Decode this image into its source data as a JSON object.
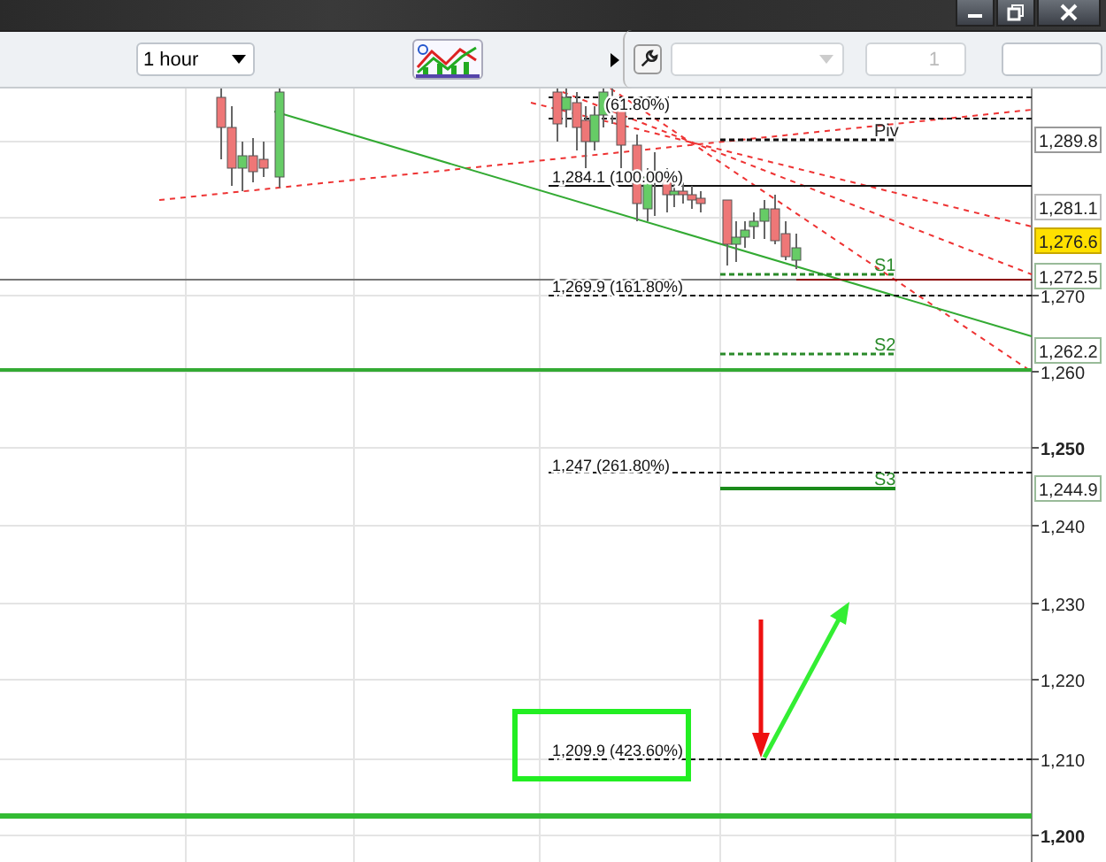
{
  "toolbar": {
    "timeframe": "1 hour",
    "quantity": {
      "value": "1",
      "disabled": true
    }
  },
  "chart": {
    "axis_labels": [
      {
        "text": "1,270",
        "major": false
      },
      {
        "text": "1,260",
        "major": false
      },
      {
        "text": "1,250",
        "major": true
      },
      {
        "text": "1,240",
        "major": false
      },
      {
        "text": "1,230",
        "major": false
      },
      {
        "text": "1,220",
        "major": false
      },
      {
        "text": "1,210",
        "major": false
      },
      {
        "text": "1,200",
        "major": true
      }
    ],
    "price_tags": [
      {
        "text": "1,289.8",
        "kind": "level"
      },
      {
        "text": "1,281.1",
        "kind": "sell"
      },
      {
        "text": "1,276.6",
        "kind": "current"
      },
      {
        "text": "1,272.5",
        "kind": "support"
      },
      {
        "text": "1,262.2",
        "kind": "support"
      },
      {
        "text": "1,244.9",
        "kind": "support"
      }
    ],
    "fib_labels": [
      "(61.80%)",
      "1,284.1 (100.00%)",
      "1,269.9 (161.80%)",
      "1,247 (261.80%)",
      "1,209.9 (423.60%)"
    ],
    "pivot_labels": [
      {
        "text": "Piv",
        "kind": "pivot"
      },
      {
        "text": "S1",
        "kind": "support"
      },
      {
        "text": "S2",
        "kind": "support"
      },
      {
        "text": "S3",
        "kind": "support"
      }
    ]
  }
}
